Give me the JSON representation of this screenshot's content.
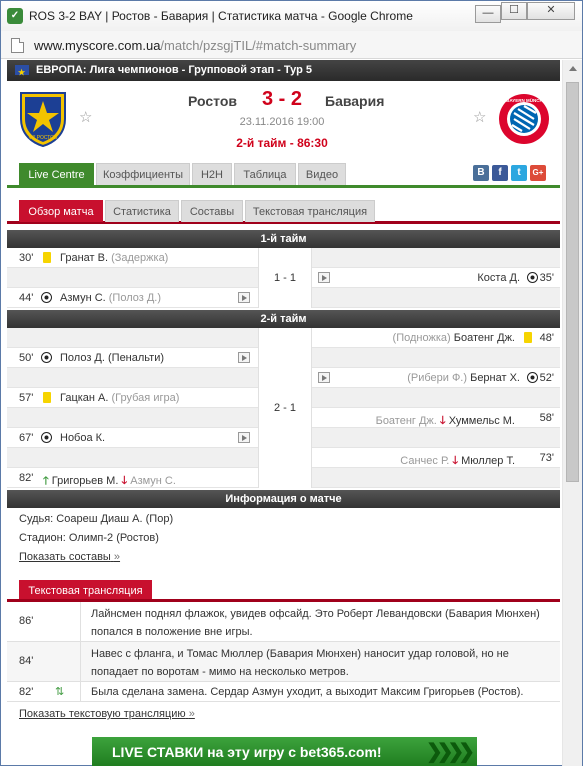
{
  "window": {
    "title": "ROS 3-2 BAY | Ростов - Бавария | Статистика матча - Google Chrome",
    "min_glyph": "—",
    "max_glyph": "☐",
    "close_glyph": "✕"
  },
  "address": {
    "domain": "www.myscore.com.ua",
    "path": "/match/pzsgjTIL/#match-summary"
  },
  "competition": "ЕВРОПА: Лига чемпионов - Групповой этап - Тур 5",
  "match": {
    "home": "Ростов",
    "away": "Бавария",
    "score": "3 - 2",
    "date": "23.11.2016 19:00",
    "status": "2-й тайм - 86:30",
    "home_logo_text": "ФК РОСТОВ",
    "away_logo_text": "FC BAYERN MÜNCHEN"
  },
  "tabs_main": [
    "Live Centre",
    "Коэффициенты",
    "H2H",
    "Таблица",
    "Видео"
  ],
  "social": [
    "В",
    "f",
    "t",
    "G+"
  ],
  "tabs_sub": [
    "Обзор матча",
    "Статистика",
    "Составы",
    "Текстовая трансляция"
  ],
  "periods": {
    "first": {
      "label": "1-й тайм",
      "score": "1 - 1",
      "events": [
        {
          "side": "home",
          "minute": "30'",
          "icon": "yellow-card",
          "player": "Гранат В.",
          "detail": "(Задержка)"
        },
        {
          "side": "away",
          "minute": "35'",
          "icon": "goal",
          "player": "Коста Д.",
          "detail": ""
        },
        {
          "side": "home",
          "minute": "44'",
          "icon": "goal",
          "player": "Азмун С.",
          "detail": "(Полоз Д.)"
        }
      ]
    },
    "second": {
      "label": "2-й тайм",
      "score": "2 - 1",
      "events": [
        {
          "side": "away",
          "minute": "48'",
          "icon": "yellow-card",
          "player": "Боатенг Дж.",
          "detail": "(Подножка)"
        },
        {
          "side": "home",
          "minute": "50'",
          "icon": "goal",
          "player": "Полоз Д.",
          "detail": "(Пенальти)"
        },
        {
          "side": "away",
          "minute": "52'",
          "icon": "goal",
          "player": "Бернат Х.",
          "detail": "(Рибери Ф.)"
        },
        {
          "side": "home",
          "minute": "57'",
          "icon": "yellow-card",
          "player": "Гацкан А.",
          "detail": "(Грубая игра)"
        },
        {
          "side": "away",
          "minute": "58'",
          "icon": "substitution",
          "player": "Хуммельс М.",
          "detail": "Боатенг Дж."
        },
        {
          "side": "home",
          "minute": "67'",
          "icon": "goal",
          "player": "Нобоа К.",
          "detail": ""
        },
        {
          "side": "away",
          "minute": "73'",
          "icon": "substitution",
          "player": "Мюллер Т.",
          "detail": "Санчес Р."
        },
        {
          "side": "home",
          "minute": "82'",
          "icon": "substitution",
          "player": "Григорьев М.",
          "detail": "Азмун С."
        }
      ]
    }
  },
  "info": {
    "header": "Информация о матче",
    "referee": "Судья: Соареш Диаш А. (Пор)",
    "stadium": "Стадион: Олимп-2 (Ростов)",
    "show_lineups": "Показать составы",
    "link_arrow": "»"
  },
  "commentary": {
    "tab": "Текстовая трансляция",
    "rows": [
      {
        "minute": "86'",
        "text": "Лайнсмен поднял флажок, увидев офсайд. Это Роберт Левандовски (Бавария Мюнхен) попался в положение вне игры."
      },
      {
        "minute": "84'",
        "text": "Навес с фланга, и Томас Мюллер (Бавария Мюнхен) наносит удар головой, но не попадает по воротам - мимо на несколько метров."
      },
      {
        "minute": "82'",
        "text": "Была сделана замена. Сердар Азмун уходит, а выходит Максим Григорьев (Ростов)."
      }
    ],
    "show_all": "Показать текстовую трансляцию"
  },
  "banner": "LIVE СТАВКИ на эту игру с bet365.com!",
  "colors": {
    "accent_red": "#d0021b",
    "tab_green": "#3f8a2c",
    "tab_red": "#c8102e"
  }
}
